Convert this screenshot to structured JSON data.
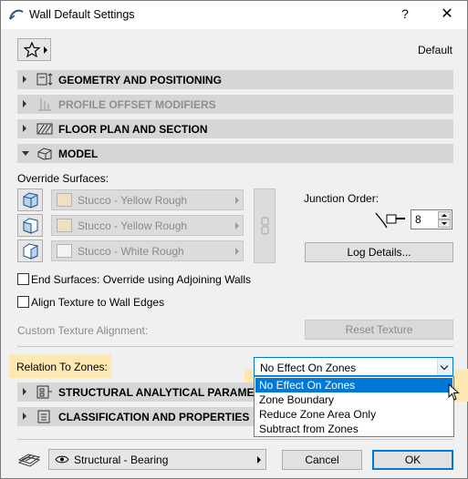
{
  "window": {
    "title": "Wall Default Settings",
    "help_label": "?",
    "close_label": "✕"
  },
  "toolbar": {
    "default_label": "Default"
  },
  "panels": {
    "geometry": "GEOMETRY AND POSITIONING",
    "profile_offset": "PROFILE OFFSET MODIFIERS",
    "floor_plan": "FLOOR PLAN AND SECTION",
    "model": "MODEL",
    "structural": "STRUCTURAL ANALYTICAL PARAMETERS",
    "classification": "CLASSIFICATION AND PROPERTIES"
  },
  "model": {
    "override_surfaces_label": "Override Surfaces:",
    "surfaces": [
      {
        "name": "Stucco - Yellow Rough",
        "color": "#f1dfc1"
      },
      {
        "name": "Stucco - Yellow Rough",
        "color": "#f1dfc1"
      },
      {
        "name": "Stucco - White Rough",
        "color": "#f3f3f3"
      }
    ],
    "junction_order_label": "Junction Order:",
    "junction_order_value": "8",
    "log_details_label": "Log Details...",
    "end_surfaces_label": "End Surfaces: Override using Adjoining Walls",
    "align_texture_label": "Align Texture to Wall Edges",
    "custom_texture_label": "Custom Texture Alignment:",
    "reset_texture_label": "Reset Texture",
    "relation_label": "Relation To Zones:",
    "relation_value": "No Effect On Zones",
    "relation_options": [
      "No Effect On Zones",
      "Zone Boundary",
      "Reduce Zone Area Only",
      "Subtract from Zones"
    ]
  },
  "footer": {
    "layer_value": "Structural - Bearing",
    "cancel_label": "Cancel",
    "ok_label": "OK"
  },
  "colors": {
    "highlight": "#fce8b0",
    "accent": "#0078d7",
    "header_bg": "#d6d6d6"
  }
}
